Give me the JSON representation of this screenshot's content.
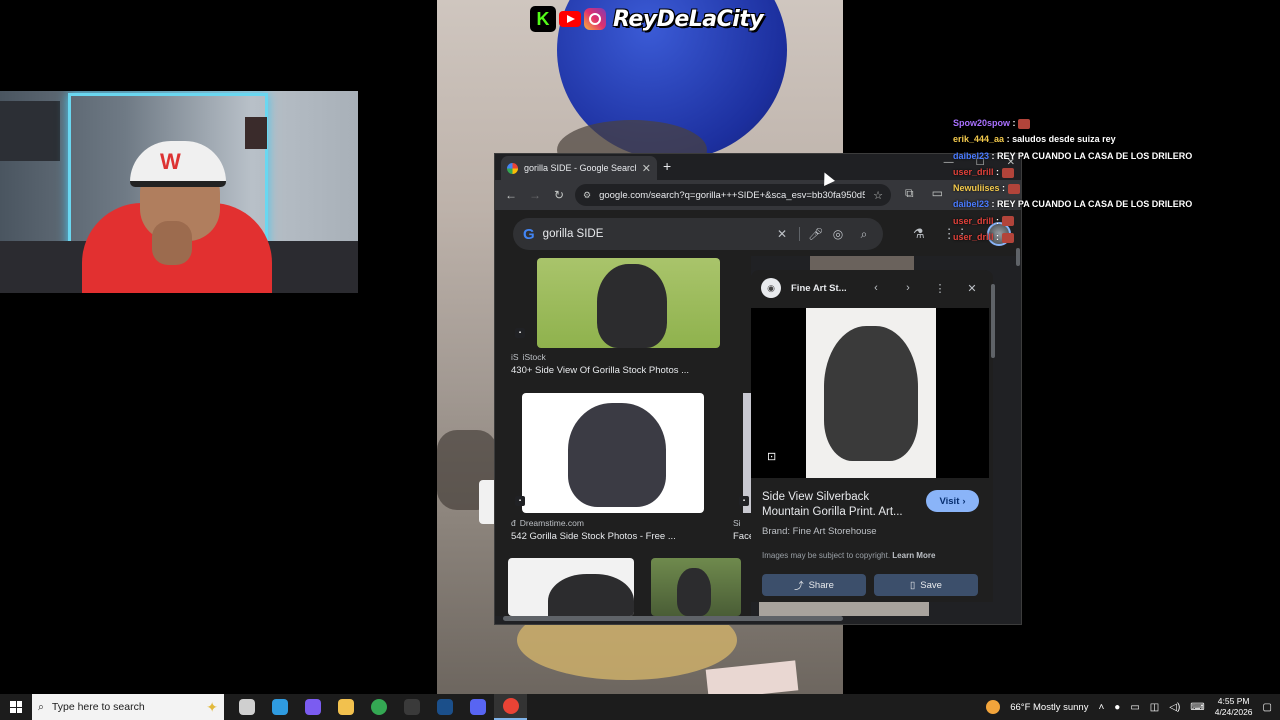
{
  "banner": {
    "channel_name": "ReyDeLaCity",
    "kick_letter": "K"
  },
  "browser": {
    "tab_title": "gorilla SIDE - Google Search",
    "new_tab": "+",
    "tab_close": "✕",
    "win_min": "—",
    "win_max": "☐",
    "win_close": "✕",
    "url": "google.com/search?q=gorilla+++SIDE+&sca_esv=bb30fa950d5...",
    "search_query": "gorilla SIDE",
    "google_letter": "G"
  },
  "results": [
    {
      "source": "iStock",
      "title": "430+ Side View Of Gorilla Stock Photos ..."
    },
    {
      "source": "Dreamstime.com",
      "title": "542 Gorilla Side Stock Photos - Free ..."
    },
    {
      "source": "Si",
      "title": "Face"
    }
  ],
  "panel": {
    "site": "Fine Art St...",
    "title": "Side View Silverback Mountain Gorilla Print. Art...",
    "visit_label": "Visit",
    "brand": "Brand: Fine Art Storehouse",
    "copyright_text": "Images may be subject to copyright.",
    "learn_more": "Learn More",
    "share_label": "Share",
    "save_label": "Save"
  },
  "chat": [
    {
      "user": "Spow20spow",
      "message": "",
      "color": "#a970ff"
    },
    {
      "user": "erik_444_aa",
      "message": "saludos desde suiza rey",
      "color": "#f2c94c"
    },
    {
      "user": "daibel23",
      "message": "REY PA CUANDO LA CASA DE LOS DRILERO",
      "color": "#4a7bff"
    },
    {
      "user": "user_drill",
      "message": "",
      "color": "#e0413a"
    },
    {
      "user": "Newuliises",
      "message": "",
      "color": "#f2c94c"
    },
    {
      "user": "daibel23",
      "message": "REY PA CUANDO LA CASA DE LOS DRILERO",
      "color": "#4a7bff"
    },
    {
      "user": "user_drill",
      "message": "",
      "color": "#e0413a"
    },
    {
      "user": "user_drill",
      "message": "",
      "color": "#e0413a"
    }
  ],
  "taskbar": {
    "search_placeholder": "Type here to search",
    "weather": "66°F  Mostly sunny",
    "time": "4:55 PM",
    "date": "4/24/2026",
    "apps": [
      {
        "name": "task-view",
        "color": "#cfcfcf"
      },
      {
        "name": "edge",
        "color": "#2f9be0"
      },
      {
        "name": "copilot",
        "color": "#7b5cf0"
      },
      {
        "name": "file-explorer",
        "color": "#f2c14e"
      },
      {
        "name": "chrome",
        "color": "#34a853"
      },
      {
        "name": "obs",
        "color": "#3a3a3a"
      },
      {
        "name": "steam",
        "color": "#1b4f8a"
      },
      {
        "name": "discord",
        "color": "#5865f2"
      },
      {
        "name": "chrome-active",
        "color": "#ea4335"
      }
    ]
  }
}
